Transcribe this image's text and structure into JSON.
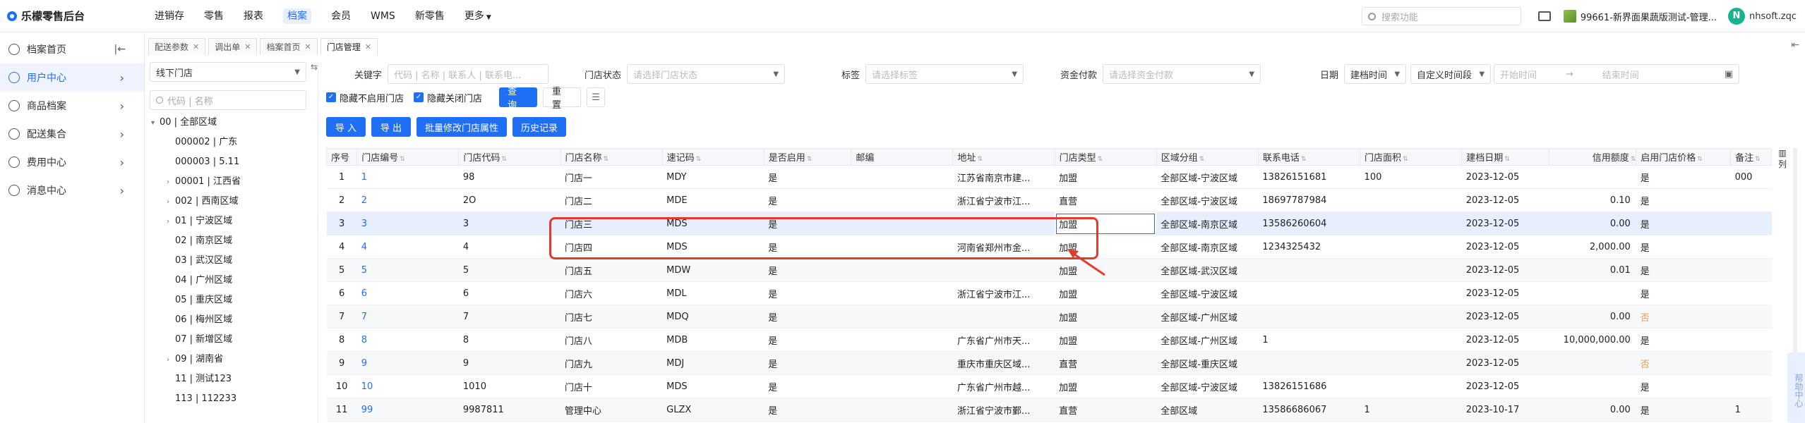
{
  "app": {
    "title": "乐檬零售后台"
  },
  "topnav": [
    "进销存",
    "零售",
    "报表",
    "档案",
    "会员",
    "WMS",
    "新零售",
    "更多"
  ],
  "topnav_active": 3,
  "search": {
    "placeholder": "搜索功能"
  },
  "store_name": "99661-新界面果蔬版测试-管理...",
  "user": {
    "avatar": "N",
    "name": "nhsoft.zqc"
  },
  "sidebar": [
    {
      "label": "档案首页",
      "icon": "home-icon"
    },
    {
      "label": "用户中心",
      "icon": "user-icon"
    },
    {
      "label": "商品档案",
      "icon": "goods-icon"
    },
    {
      "label": "配送集合",
      "icon": "delivery-icon"
    },
    {
      "label": "费用中心",
      "icon": "cost-icon"
    },
    {
      "label": "消息中心",
      "icon": "bell-icon"
    }
  ],
  "sidebar_active": 1,
  "tabs": [
    "配送参数",
    "调出单",
    "档案首页",
    "门店管理"
  ],
  "tabs_active": 3,
  "tree": {
    "store_type": "线下门店",
    "search_placeholder": "代码 | 名称",
    "nodes": [
      {
        "text": "00 | 全部区域",
        "level": 0,
        "arrow": "▾"
      },
      {
        "text": "000002 | 广东",
        "level": 1,
        "arrow": ""
      },
      {
        "text": "000003 | 5.11",
        "level": 1,
        "arrow": ""
      },
      {
        "text": "00001 | 江西省",
        "level": 1,
        "arrow": "›"
      },
      {
        "text": "002 | 西南区域",
        "level": 1,
        "arrow": "›"
      },
      {
        "text": "01 | 宁波区域",
        "level": 1,
        "arrow": "›"
      },
      {
        "text": "02 | 南京区域",
        "level": 1,
        "arrow": ""
      },
      {
        "text": "03 | 武汉区域",
        "level": 1,
        "arrow": ""
      },
      {
        "text": "04 | 广州区域",
        "level": 1,
        "arrow": ""
      },
      {
        "text": "05 | 重庆区域",
        "level": 1,
        "arrow": ""
      },
      {
        "text": "06 | 梅州区域",
        "level": 1,
        "arrow": ""
      },
      {
        "text": "07 | 新增区域",
        "level": 1,
        "arrow": ""
      },
      {
        "text": "09 | 湖南省",
        "level": 1,
        "arrow": "›"
      },
      {
        "text": "11 | 测试123",
        "level": 1,
        "arrow": ""
      },
      {
        "text": "113 | 112233",
        "level": 1,
        "arrow": ""
      }
    ]
  },
  "filters": {
    "keyword_label": "关键字",
    "keyword_placeholder": "代码 | 名称 | 联系人 | 联系电...",
    "status_label": "门店状态",
    "status_placeholder": "请选择门店状态",
    "tag_label": "标签",
    "tag_placeholder": "请选择标签",
    "payment_label": "资金付款",
    "payment_placeholder": "请选择资金付款",
    "date_label": "日期",
    "date_type": "建档时间",
    "date_range_type": "自定义时间段",
    "start_placeholder": "开始时间",
    "end_placeholder": "结束时间",
    "hide_disabled": "隐藏不启用门店",
    "hide_closed": "隐藏关闭门店",
    "query": "查 询",
    "reset": "重 置"
  },
  "actions": [
    "导 入",
    "导 出",
    "批量修改门店属性",
    "历史记录"
  ],
  "table": {
    "columns": [
      "序号",
      "门店编号",
      "门店代码",
      "门店名称",
      "速记码",
      "是否启用",
      "邮编",
      "地址",
      "门店类型",
      "区域分组",
      "联系电话",
      "门店面积",
      "建档日期",
      "信用额度",
      "启用门店价格",
      "备注"
    ],
    "rows": [
      [
        "1",
        "1",
        "98",
        "门店一",
        "MDY",
        "是",
        "",
        "江苏省南京市建...",
        "加盟",
        "全部区域-宁波区域",
        "13826151681",
        "100",
        "2023-12-05",
        "",
        "是",
        "000"
      ],
      [
        "2",
        "2",
        "2O",
        "门店二",
        "MDE",
        "是",
        "",
        "浙江省宁波市江...",
        "直营",
        "全部区域-宁波区域",
        "18697787984",
        "",
        "2023-12-05",
        "0.10",
        "是",
        ""
      ],
      [
        "3",
        "3",
        "3",
        "门店三",
        "MDS",
        "是",
        "",
        "",
        "加盟",
        "全部区域-南京区域",
        "13586260604",
        "",
        "2023-12-05",
        "0.00",
        "是",
        ""
      ],
      [
        "4",
        "4",
        "4",
        "门店四",
        "MDS",
        "是",
        "",
        "河南省郑州市金...",
        "加盟",
        "全部区域-南京区域",
        "1234325432",
        "",
        "2023-12-05",
        "2,000.00",
        "是",
        ""
      ],
      [
        "5",
        "5",
        "5",
        "门店五",
        "MDW",
        "是",
        "",
        "",
        "加盟",
        "全部区域-武汉区域",
        "",
        "",
        "2023-12-05",
        "0.01",
        "是",
        ""
      ],
      [
        "6",
        "6",
        "6",
        "门店六",
        "MDL",
        "是",
        "",
        "浙江省宁波市江...",
        "加盟",
        "全部区域-宁波区域",
        "",
        "",
        "2023-12-05",
        "",
        "是",
        ""
      ],
      [
        "7",
        "7",
        "7",
        "门店七",
        "MDQ",
        "是",
        "",
        "",
        "加盟",
        "全部区域-广州区域",
        "",
        "",
        "2023-12-05",
        "0.00",
        "否",
        ""
      ],
      [
        "8",
        "8",
        "8",
        "门店八",
        "MDB",
        "是",
        "",
        "广东省广州市天...",
        "加盟",
        "全部区域-广州区域",
        "1",
        "",
        "2023-12-05",
        "10,000,000.00",
        "是",
        ""
      ],
      [
        "9",
        "9",
        "9",
        "门店九",
        "MDJ",
        "是",
        "",
        "重庆市重庆区域...",
        "直营",
        "全部区域-重庆区域",
        "",
        "",
        "2023-12-05",
        "",
        "否",
        ""
      ],
      [
        "10",
        "10",
        "1010",
        "门店十",
        "MDS",
        "是",
        "",
        "广东省广州市越...",
        "加盟",
        "全部区域-宁波区域",
        "13826151686",
        "",
        "2023-12-05",
        "",
        "是",
        ""
      ],
      [
        "11",
        "99",
        "9987811",
        "管理中心",
        "GLZX",
        "是",
        "",
        "浙江省宁波市鄞...",
        "直营",
        "全部区域",
        "13586686067",
        "1",
        "2023-10-17",
        "0.00",
        "是",
        "1"
      ]
    ]
  },
  "right_panel_label": "列",
  "help_label": "帮助中心"
}
